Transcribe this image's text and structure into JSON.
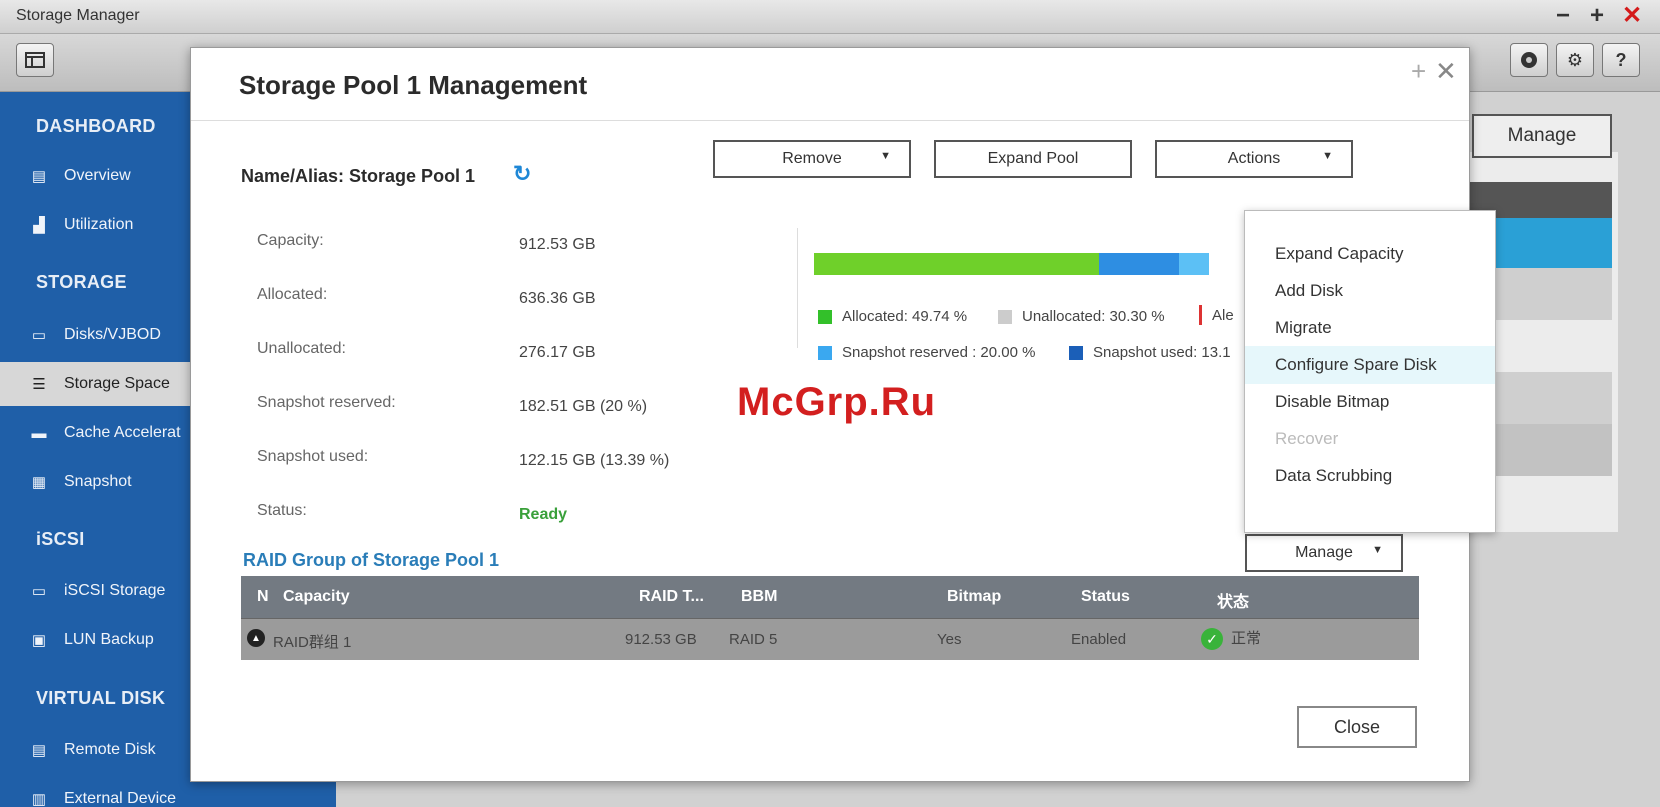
{
  "app": {
    "title": "Storage Manager",
    "minimize": "−",
    "maximize": "+",
    "close": "✕"
  },
  "sidebar": {
    "sections": {
      "dashboard": "DASHBOARD",
      "storage": "STORAGE",
      "iscsi": "iSCSI",
      "virtual_disk": "VIRTUAL DISK"
    },
    "items": [
      {
        "label": "Overview",
        "icon": "overview-icon"
      },
      {
        "label": "Utilization",
        "icon": "utilization-icon"
      },
      {
        "label": "Disks/VJBOD",
        "icon": "disk-icon"
      },
      {
        "label": "Storage Space",
        "icon": "storage-space-icon"
      },
      {
        "label": "Cache Accelerat",
        "icon": "cache-icon"
      },
      {
        "label": "Snapshot",
        "icon": "snapshot-icon"
      },
      {
        "label": "iSCSI Storage",
        "icon": "iscsi-storage-icon"
      },
      {
        "label": "LUN Backup",
        "icon": "lun-backup-icon"
      },
      {
        "label": "Remote Disk",
        "icon": "remote-disk-icon"
      },
      {
        "label": "External Device",
        "icon": "external-device-icon"
      }
    ]
  },
  "background": {
    "manage_label": "Manage"
  },
  "dialog": {
    "title": "Storage Pool 1 Management",
    "plus": "+",
    "close_x": "✕",
    "pool_name": "Name/Alias: Storage Pool 1",
    "buttons": {
      "remove": "Remove",
      "expand_pool": "Expand Pool",
      "actions": "Actions",
      "manage": "Manage",
      "close": "Close"
    },
    "info": [
      {
        "label": "Capacity:",
        "value": "912.53 GB"
      },
      {
        "label": "Allocated:",
        "value": "636.36 GB"
      },
      {
        "label": "Unallocated:",
        "value": "276.17 GB"
      },
      {
        "label": "Snapshot reserved:",
        "value": "182.51 GB (20 %)"
      },
      {
        "label": "Snapshot used:",
        "value": "122.15 GB (13.39 %)"
      },
      {
        "label": "Status:",
        "value": "Ready"
      }
    ],
    "usage": {
      "allocated_pct": 49.74,
      "snapshot_reserved_pct": 20.0,
      "colors": {
        "allocated": "#6fd02a",
        "snapshot_used": "#2e8ee2",
        "snapshot_reserved": "#5cc0f5",
        "unallocated": "#cccccc",
        "alert": "#d33"
      }
    },
    "legend": {
      "allocated": "Allocated: 49.74 %",
      "unallocated": "Unallocated: 30.30 %",
      "alert": "Ale",
      "snapshot_reserved": "Snapshot reserved : 20.00 %",
      "snapshot_used": "Snapshot used: 13.1"
    },
    "raid_title": "RAID Group of Storage Pool 1",
    "table": {
      "headers": [
        "N",
        "Capacity",
        "RAID T...",
        "BBM",
        "Bitmap",
        "Status",
        "状态"
      ],
      "row": {
        "name": "RAID群组 1",
        "capacity": "912.53 GB",
        "raid_type": "RAID 5",
        "bitmap": "Yes",
        "status": "Enabled",
        "state": "正常"
      }
    }
  },
  "actions_menu": [
    {
      "label": "Expand Capacity",
      "state": "normal"
    },
    {
      "label": "Add Disk",
      "state": "normal"
    },
    {
      "label": "Migrate",
      "state": "normal"
    },
    {
      "label": "Configure Spare Disk",
      "state": "hover"
    },
    {
      "label": "Disable Bitmap",
      "state": "normal"
    },
    {
      "label": "Recover",
      "state": "disabled"
    },
    {
      "label": "Data Scrubbing",
      "state": "normal"
    }
  ],
  "watermark": "McGrp.Ru"
}
